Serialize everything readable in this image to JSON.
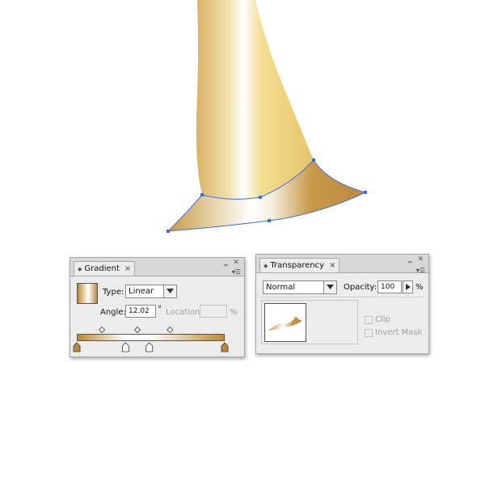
{
  "gradient_panel": {
    "tab_label": "Gradient",
    "type_label": "Type:",
    "type_value": "Linear",
    "angle_label": "Angle:",
    "angle_value": "12.02",
    "angle_unit": "°",
    "location_label": "Location:",
    "location_value": "",
    "location_unit": "%",
    "stops": [
      {
        "position": 0,
        "color": "#b98a3c"
      },
      {
        "position": 33,
        "color": "#ffffff"
      },
      {
        "position": 49,
        "color": "#ffffff"
      },
      {
        "position": 100,
        "color": "#b98a3c"
      }
    ],
    "midpoints": [
      17,
      41,
      63
    ]
  },
  "transparency_panel": {
    "tab_label": "Transparency",
    "blend_mode": "Normal",
    "opacity_label": "Opacity:",
    "opacity_value": "100",
    "opacity_unit": "%",
    "clip_label": "Clip",
    "invert_mask_label": "Invert Mask"
  },
  "colors": {
    "gold_dark": "#b98a3c",
    "gold_light": "#f2d98c",
    "highlight": "#ffffff",
    "selection": "#3a6ee8"
  },
  "icons": {
    "close": "×",
    "collapse": "«",
    "menu": "▾☰",
    "dropdown": "▼",
    "stepper": "▶"
  }
}
